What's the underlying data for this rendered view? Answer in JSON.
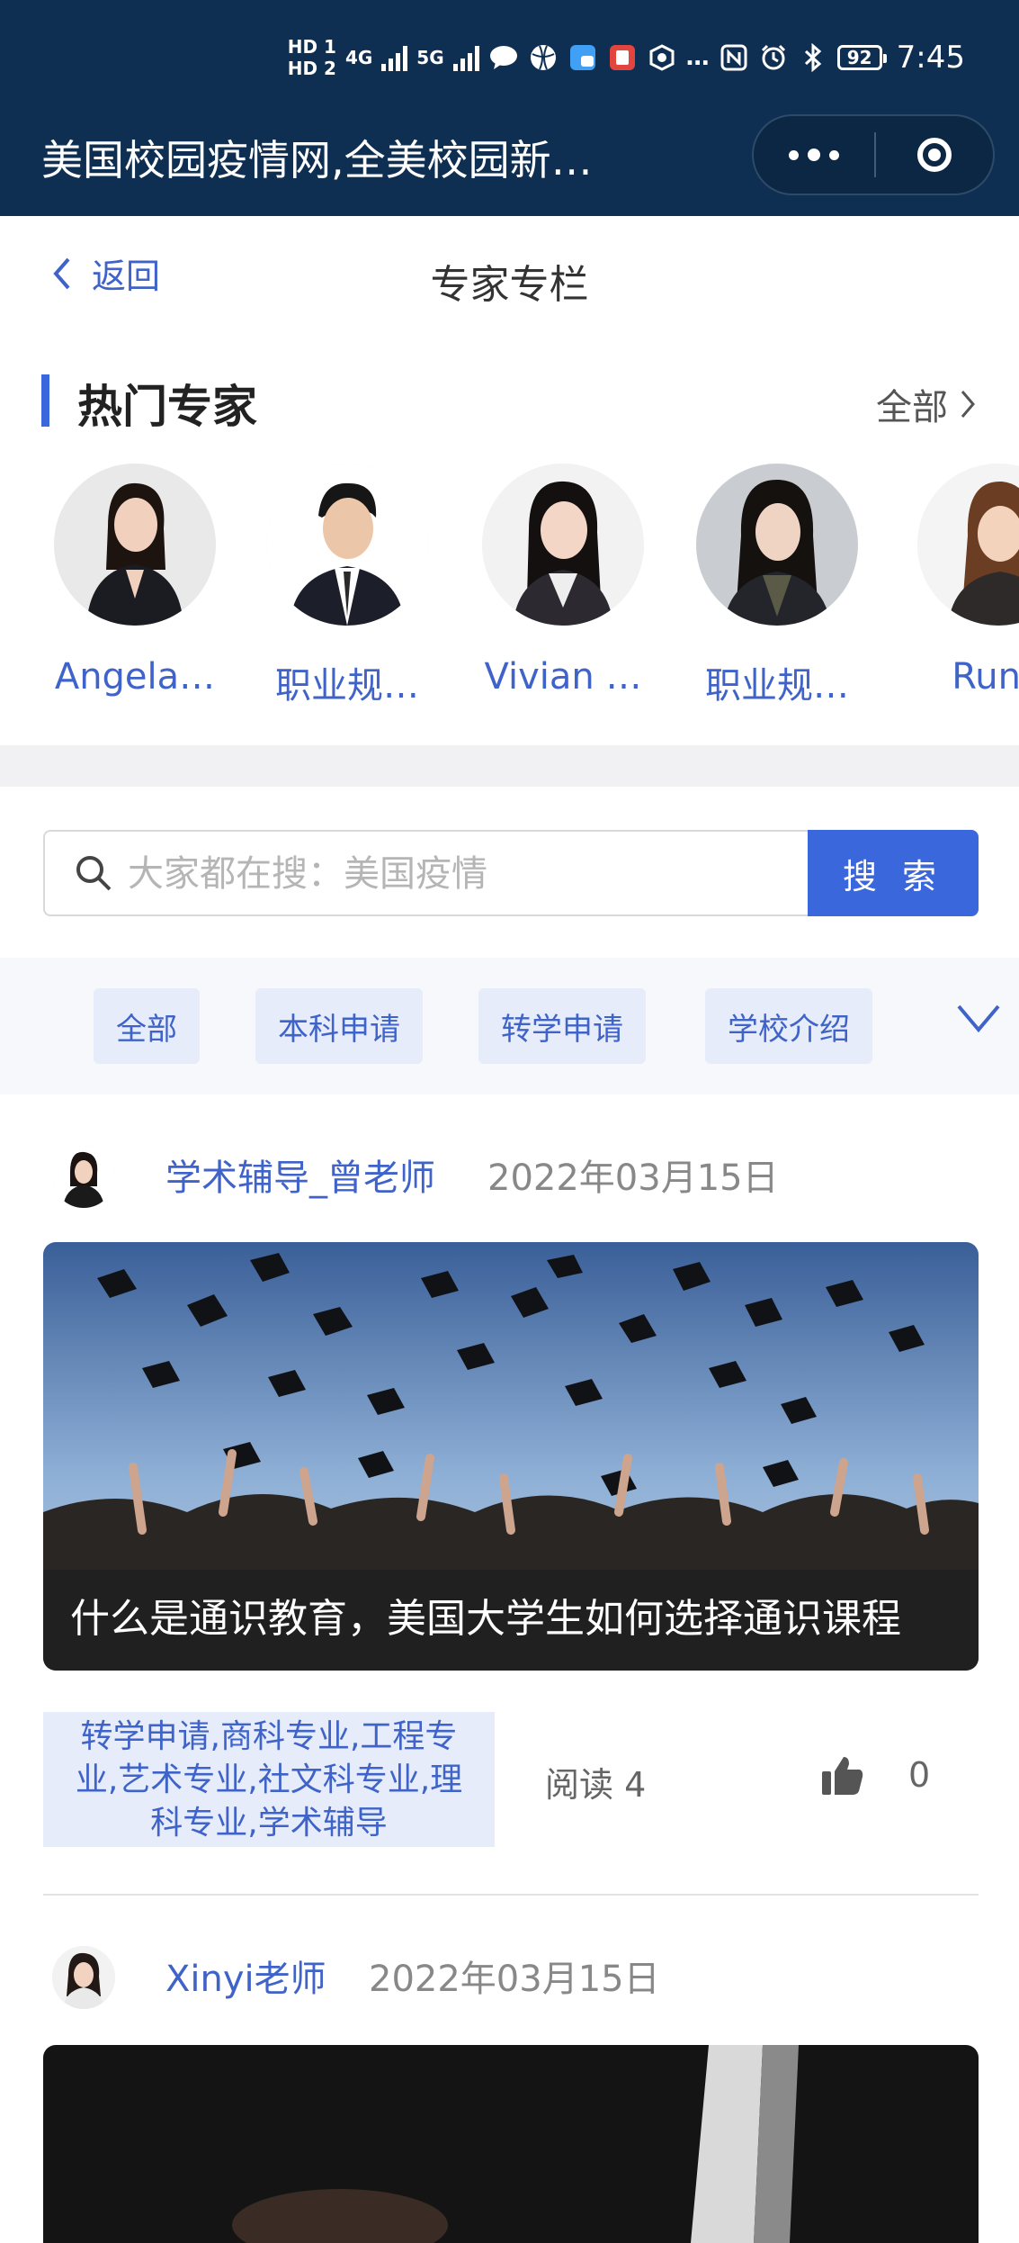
{
  "status_bar": {
    "signal_labels": [
      "HD 1",
      "HD 2",
      "4G",
      "5G"
    ],
    "battery": "92",
    "time": "7:45",
    "icons": [
      "signal-bars-icon",
      "chat-bubble-icon",
      "basketball-icon",
      "app-blue-icon",
      "app-red-icon",
      "app-badge-icon",
      "nfc-icon",
      "alarm-icon",
      "bluetooth-icon"
    ]
  },
  "header": {
    "app_title": "美国校园疫情网,全美校园新…"
  },
  "nav": {
    "back_label": "返回",
    "title": "专家专栏"
  },
  "hot_experts": {
    "title": "热门专家",
    "all_label": "全部",
    "items": [
      {
        "name": "Angela…"
      },
      {
        "name": "职业规…"
      },
      {
        "name": "Vivian …"
      },
      {
        "name": "职业规…"
      },
      {
        "name": "Runti"
      }
    ]
  },
  "search": {
    "placeholder": "大家都在搜：美国疫情",
    "button_label": "搜 索"
  },
  "categories": [
    "全部",
    "本科申请",
    "转学申请",
    "学校介绍"
  ],
  "articles": [
    {
      "author": "学术辅导_曾老师",
      "date": "2022年03月15日",
      "title": "什么是通识教育，美国大学生如何选择通识课程",
      "tags": "转学申请,商科专业,工程专业,艺术专业,社文科专业,理科专业,学术辅导",
      "reads": "阅读 4",
      "likes": "0"
    },
    {
      "author": "Xinyi老师",
      "date": "2022年03月15日"
    }
  ],
  "colors": {
    "header_bg": "#0f2f52",
    "accent": "#3a67dc",
    "link": "#3f63c8",
    "tag_bg": "#e6ecf9"
  }
}
